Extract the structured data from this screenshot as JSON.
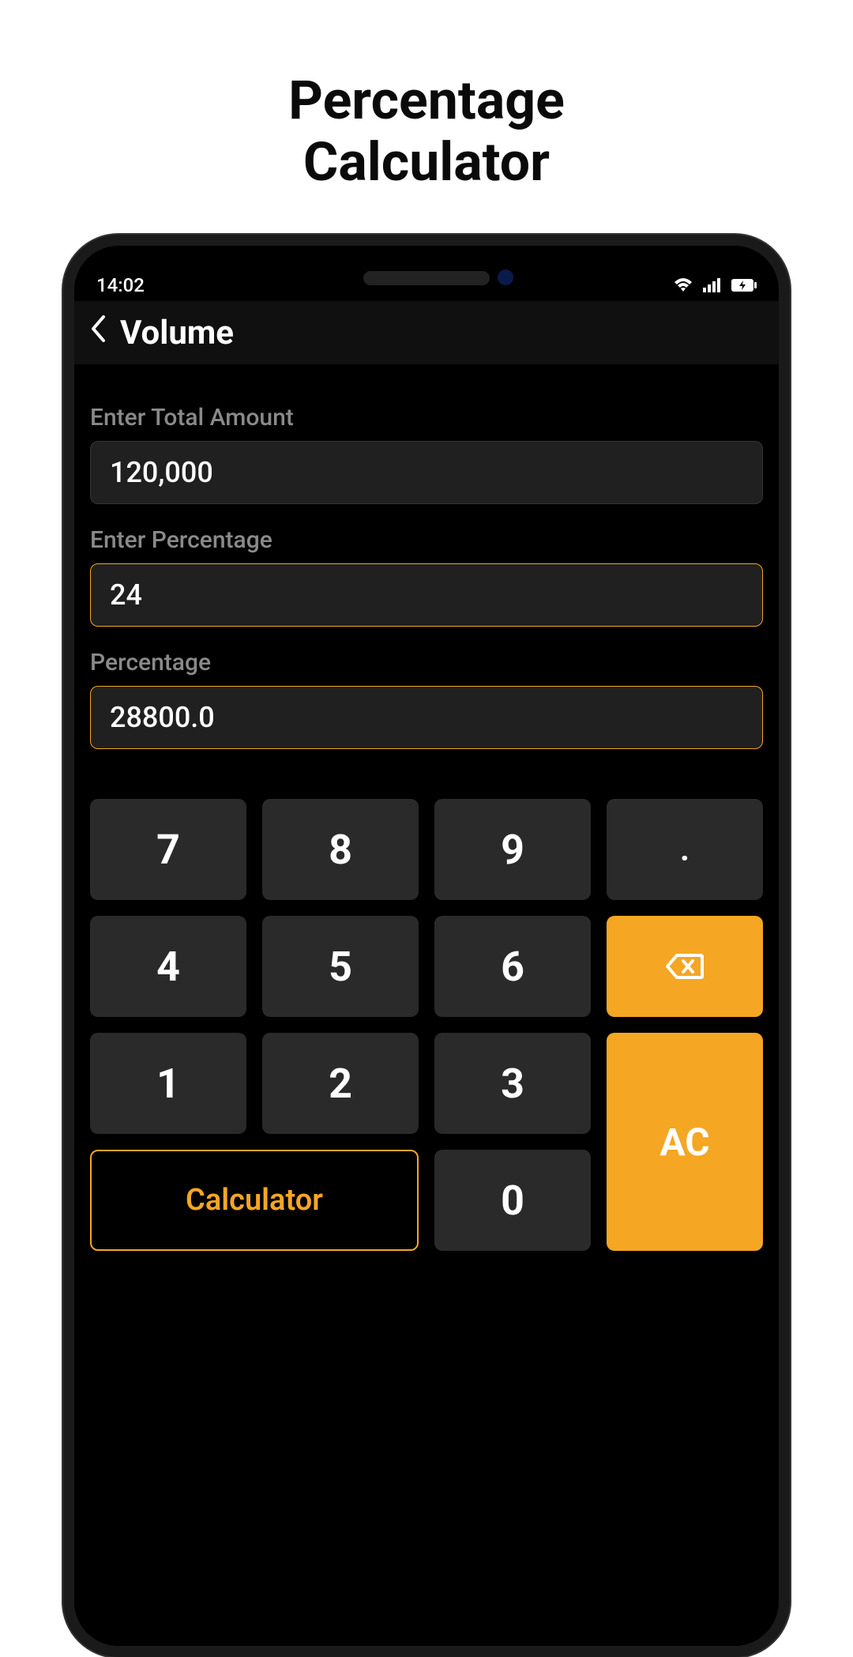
{
  "page_title_line1": "Percentage",
  "page_title_line2": "Calculator",
  "status": {
    "time": "14:02"
  },
  "header": {
    "title": "Volume"
  },
  "fields": {
    "total_label": "Enter Total Amount",
    "total_value": "120,000",
    "percent_label": "Enter Percentage",
    "percent_value": "24",
    "result_label": "Percentage",
    "result_value": "28800.0"
  },
  "keypad": {
    "k7": "7",
    "k8": "8",
    "k9": "9",
    "dot": ".",
    "k4": "4",
    "k5": "5",
    "k6": "6",
    "k1": "1",
    "k2": "2",
    "k3": "3",
    "calculator": "Calculator",
    "k0": "0",
    "ac": "AC"
  }
}
